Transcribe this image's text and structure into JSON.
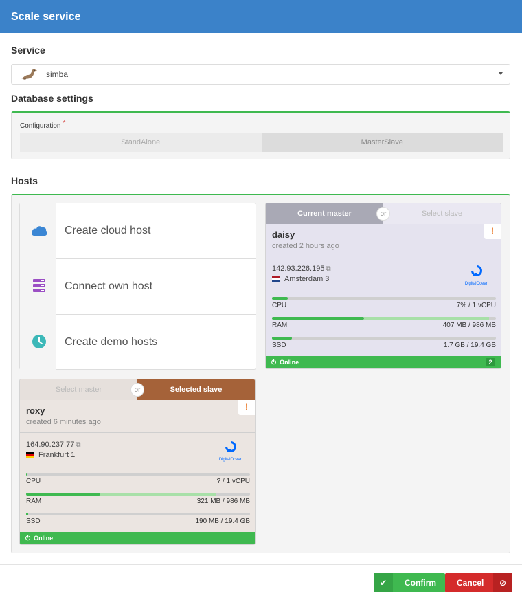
{
  "dialog": {
    "title": "Scale service"
  },
  "service": {
    "section_label": "Service",
    "selected": "simba",
    "icon": "seal-icon"
  },
  "database": {
    "section_label": "Database settings",
    "config_label": "Configuration",
    "required_mark": "*",
    "options": [
      "StandAlone",
      "MasterSlave"
    ],
    "selected": "MasterSlave"
  },
  "hosts": {
    "section_label": "Hosts",
    "create_options": [
      {
        "label": "Create cloud host",
        "icon": "cloud-icon"
      },
      {
        "label": "Connect own host",
        "icon": "server-icon"
      },
      {
        "label": "Create demo hosts",
        "icon": "clock-icon"
      }
    ],
    "cards": [
      {
        "toggle_left": "Current master",
        "toggle_or": "or",
        "toggle_right": "Select slave",
        "name": "daisy",
        "created": "created 2 hours ago",
        "warning": "!",
        "ip": "142.93.226.195",
        "location": "Amsterdam 3",
        "provider": "DigitalOcean",
        "cpu": {
          "label": "CPU",
          "value": "7% / 1 vCPU",
          "usage": 0.07
        },
        "ram": {
          "label": "RAM",
          "value": "407 MB / 986 MB",
          "usage": 0.41,
          "cache": 0.97
        },
        "ssd": {
          "label": "SSD",
          "value": "1.7 GB / 19.4 GB",
          "usage": 0.088
        },
        "status": "Online",
        "count": "2",
        "colors": {
          "toggle_active": "#a9a9b5",
          "body": "#e5e3ef"
        }
      },
      {
        "toggle_left": "Select master",
        "toggle_or": "or",
        "toggle_right": "Selected slave",
        "name": "roxy",
        "created": "created 6 minutes ago",
        "warning": "!",
        "ip": "164.90.237.77",
        "location": "Frankfurt 1",
        "provider": "DigitalOcean",
        "cpu": {
          "label": "CPU",
          "value": "? / 1 vCPU",
          "usage": 0.0
        },
        "ram": {
          "label": "RAM",
          "value": "321 MB / 986 MB",
          "usage": 0.33,
          "cache": 0.85
        },
        "ssd": {
          "label": "SSD",
          "value": "190 MB / 19.4 GB",
          "usage": 0.01
        },
        "status": "Online",
        "colors": {
          "toggle_active": "#a56239",
          "body": "#ebe5e1"
        }
      }
    ]
  },
  "footer": {
    "confirm_label": "Confirm",
    "cancel_label": "Cancel"
  }
}
